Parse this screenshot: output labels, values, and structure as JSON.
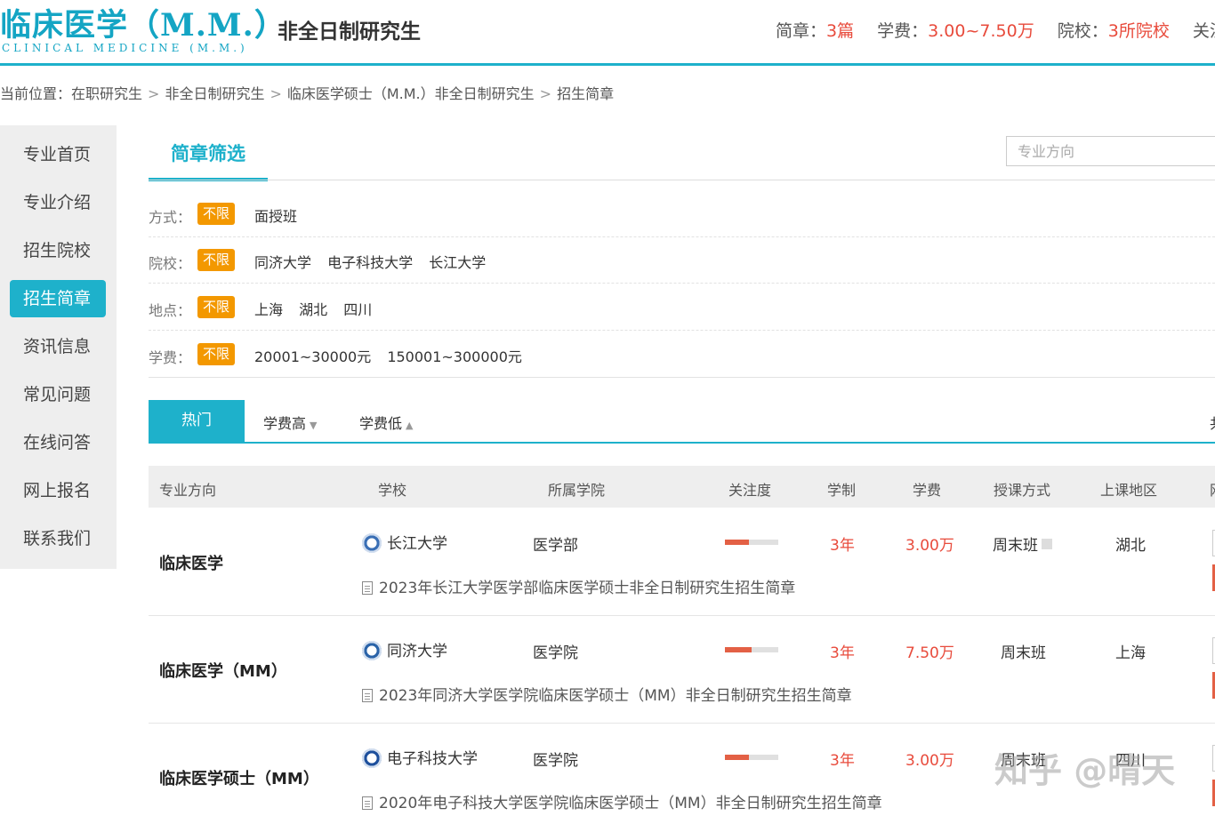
{
  "header": {
    "logo_cn": "临床医学（M.M.）",
    "logo_en": "CLINICAL MEDICINE (M.M.)",
    "subtitle": "非全日制研究生",
    "stats": [
      {
        "label": "简章：",
        "value": "3篇"
      },
      {
        "label": "学费：",
        "value": "3.00~7.50万"
      },
      {
        "label": "院校：",
        "value": "3所院校"
      },
      {
        "label": "关注度",
        "value": ""
      }
    ]
  },
  "breadcrumb": {
    "prefix": "当前位置：",
    "items": [
      "在职研究生",
      "非全日制研究生",
      "临床医学硕士（M.M.）非全日制研究生",
      "招生简章"
    ],
    "separator": ">"
  },
  "sidebar": {
    "items": [
      {
        "label": "专业首页"
      },
      {
        "label": "专业介绍"
      },
      {
        "label": "招生院校"
      },
      {
        "label": "招生简章",
        "active": true
      },
      {
        "label": "资讯信息"
      },
      {
        "label": "常见问题"
      },
      {
        "label": "在线问答"
      },
      {
        "label": "网上报名"
      },
      {
        "label": "联系我们"
      }
    ]
  },
  "filter": {
    "title": "简章筛选",
    "search_placeholder": "专业方向",
    "unlimited_label": "不限",
    "rows": [
      {
        "label": "方式：",
        "options": [
          "面授班"
        ]
      },
      {
        "label": "院校：",
        "options": [
          "同济大学",
          "电子科技大学",
          "长江大学"
        ]
      },
      {
        "label": "地点：",
        "options": [
          "上海",
          "湖北",
          "四川"
        ]
      },
      {
        "label": "学费：",
        "options": [
          "20001~30000元",
          "150001~300000元"
        ]
      }
    ]
  },
  "sort": {
    "hot": "热门",
    "fee_high": "学费高",
    "fee_low": "学费低",
    "more": "共"
  },
  "table": {
    "headers": [
      "专业方向",
      "学校",
      "所属学院",
      "关注度",
      "学制",
      "学费",
      "授课方式",
      "上课地区",
      "网"
    ],
    "rows": [
      {
        "major": "临床医学",
        "school": "长江大学",
        "college": "医学部",
        "attention": 0.45,
        "years": "3年",
        "fee": "3.00万",
        "mode": "周末班",
        "region": "湖北",
        "brochure": "2023年长江大学医学部临床医学硕士非全日制研究生招生简章",
        "badge_color": "#3a6fb5"
      },
      {
        "major": "临床医学（MM）",
        "school": "同济大学",
        "college": "医学院",
        "attention": 0.5,
        "years": "3年",
        "fee": "7.50万",
        "mode": "周末班",
        "region": "上海",
        "brochure": "2023年同济大学医学院临床医学硕士（MM）非全日制研究生招生简章",
        "badge_color": "#2a63a8"
      },
      {
        "major": "临床医学硕士（MM）",
        "school": "电子科技大学",
        "college": "医学院",
        "attention": 0.45,
        "years": "3年",
        "fee": "3.00万",
        "mode": "周末班",
        "region": "四川",
        "brochure": "2020年电子科技大学医学院临床医学硕士（MM）非全日制研究生招生简章",
        "badge_color": "#1d4f9c"
      }
    ]
  },
  "watermark": "知乎 @晴天",
  "colors": {
    "accent": "#1eb1cb",
    "price": "#e84b3c",
    "tag": "#f39800"
  }
}
